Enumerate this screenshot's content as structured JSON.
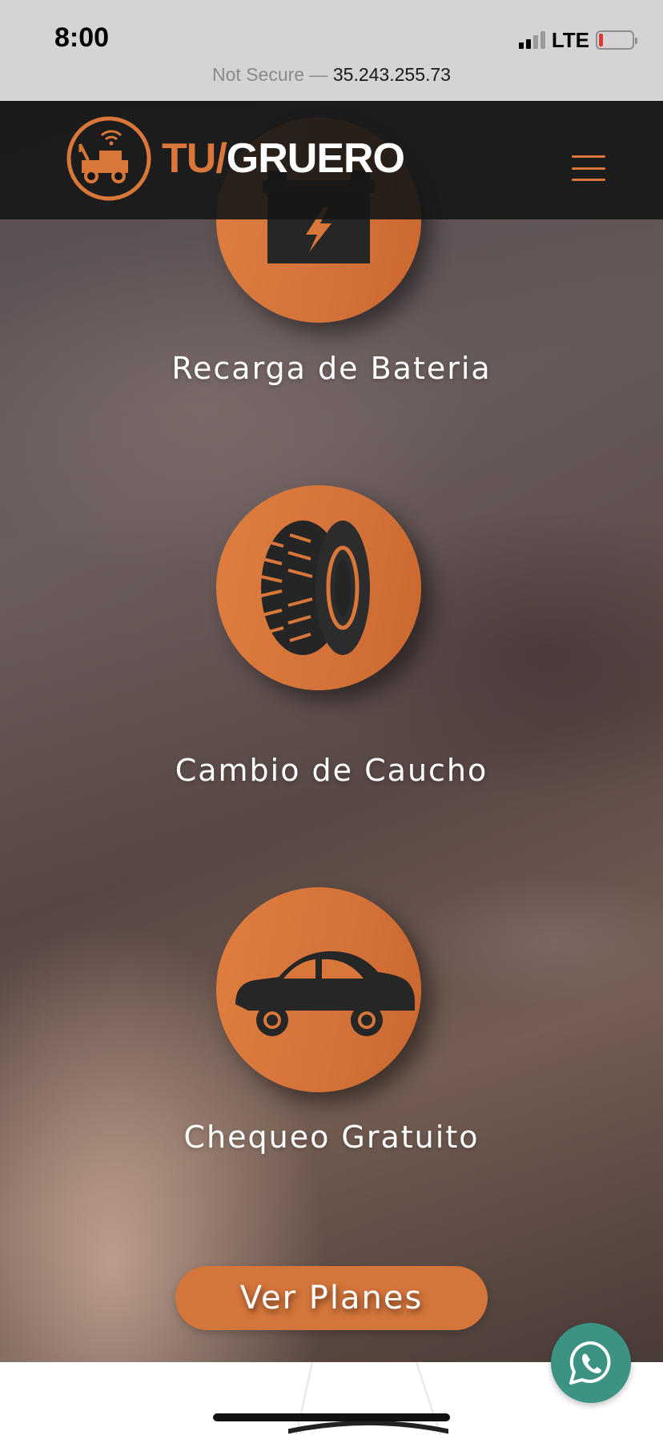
{
  "status_bar": {
    "time": "8:00",
    "network": "LTE",
    "battery_level_fraction": 0.1,
    "signal_bars_active": 2,
    "signal_bars_total": 4
  },
  "address_bar": {
    "security_label": "Not Secure —",
    "host": "35.243.255.73"
  },
  "header": {
    "logo_tu": "TU/",
    "logo_gruero": "GRUERO",
    "menu_icon": "hamburger-icon"
  },
  "services": [
    {
      "label": "Recarga de Bateria",
      "icon": "battery-icon"
    },
    {
      "label": "Cambio de Caucho",
      "icon": "tire-icon"
    },
    {
      "label": "Chequeo Gratuito",
      "icon": "car-icon"
    }
  ],
  "cta": {
    "label": "Ver Planes"
  },
  "whatsapp": {
    "icon": "whatsapp-icon"
  },
  "colors": {
    "accent": "#d9773a",
    "header_bg": "#161616",
    "whatsapp_green": "#3d9383",
    "status_bar_bg": "#d4d4d6"
  }
}
